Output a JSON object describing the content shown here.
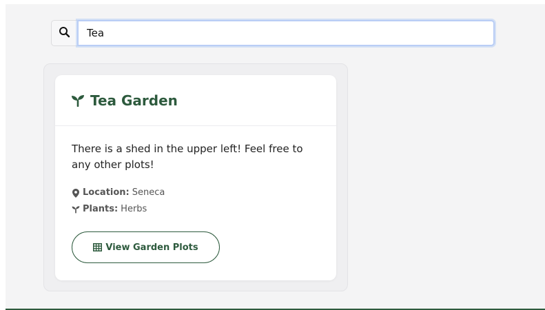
{
  "search": {
    "value": "Tea",
    "icon": "search-icon"
  },
  "garden": {
    "name": "Tea Garden",
    "title_icon": "seedling-icon",
    "description": "There is a shed in the upper left! Feel free to any other plots!",
    "location_label": "Location:",
    "location_value": "Seneca",
    "location_icon": "map-marker-icon",
    "plants_label": "Plants:",
    "plants_value": "Herbs",
    "plants_icon": "seedling-icon",
    "button_label": "View Garden Plots",
    "button_icon": "table-grid-icon"
  },
  "colors": {
    "accent": "#2d5a3d",
    "focus_ring": "#b9cdf5",
    "panel_bg": "#f4f4f5"
  }
}
